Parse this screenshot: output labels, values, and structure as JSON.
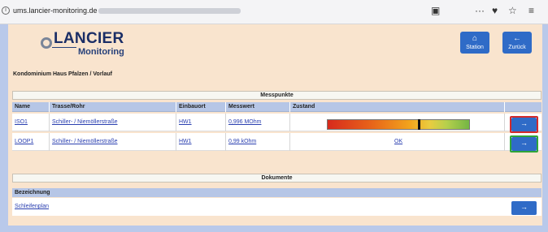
{
  "browser": {
    "url_domain": "ums.lancier-monitoring.de",
    "info_glyph": "i",
    "reader_glyph": "▣",
    "more_glyph": "···",
    "pocket_glyph": "♥",
    "star_glyph": "☆",
    "menu_glyph": "≡"
  },
  "logo": {
    "name": "LANCIER",
    "sub": "Monitoring"
  },
  "nav": {
    "station": {
      "glyph": "⌂",
      "label": "Station"
    },
    "back": {
      "glyph": "←",
      "label": "Zurück"
    }
  },
  "breadcrumb": "Kondominium Haus Pfalzen / Vorlauf",
  "messpunkte": {
    "title": "Messpunkte",
    "columns": [
      "Name",
      "Trasse/Rohr",
      "Einbauort",
      "Messwert",
      "Zustand"
    ],
    "rows": [
      {
        "name": "ISO1",
        "trasse": "Schiller- / Niemöllerstraße",
        "einbauort": "HW1",
        "messwert": "0,996 MOhm",
        "zustand": "",
        "gauge_level": 0.64,
        "status": "alarm"
      },
      {
        "name": "LOOP1",
        "trasse": "Schiller- / Niemöllerstraße",
        "einbauort": "HW1",
        "messwert": "0,99 kOhm",
        "zustand": "OK",
        "status": "ok"
      }
    ],
    "button_glyph": "→"
  },
  "dokumente": {
    "title": "Dokumente",
    "column": "Bezeichnung",
    "rows": [
      {
        "name": "Schleifenplan"
      }
    ],
    "button_glyph": "→"
  },
  "colors": {
    "alarm": "#d42a2a",
    "ok": "#2fa53a",
    "accent": "#2f6bc7"
  }
}
